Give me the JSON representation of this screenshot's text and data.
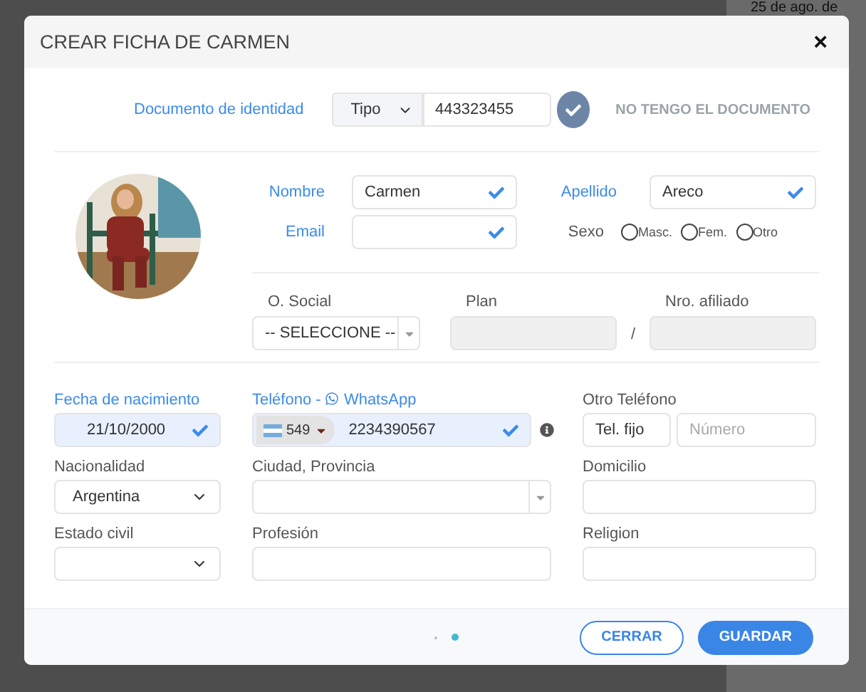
{
  "backdrop": {
    "date": "25 de ago. de"
  },
  "modal": {
    "title": "CREAR FICHA DE CARMEN",
    "close": "×"
  },
  "document": {
    "label": "Documento de identidad",
    "type": "Tipo",
    "value": "443323455",
    "confirmed": true,
    "no_document": "NO TENGO EL DOCUMENTO"
  },
  "person": {
    "name": {
      "label": "Nombre",
      "value": "Carmen",
      "required": true,
      "valid": true
    },
    "surname": {
      "label": "Apellido",
      "value": "Areco",
      "required": true,
      "valid": true
    },
    "email": {
      "label": "Email",
      "required": true,
      "valid": true
    },
    "sex": {
      "label": "Sexo",
      "options": [
        {
          "label": "Masc.",
          "selected": false
        },
        {
          "label": "Fem.",
          "selected": false
        },
        {
          "label": "Otro",
          "selected": false
        }
      ]
    }
  },
  "insurance": {
    "social": {
      "label": "O. Social",
      "value": "-- SELECCIONE --"
    },
    "plan": {
      "label": "Plan"
    },
    "separator": "/",
    "member": {
      "label": "Nro. afiliado"
    }
  },
  "birth": {
    "label": "Fecha de nacimiento",
    "value": "21/10/2000",
    "required": true,
    "valid": true,
    "autofilled": true
  },
  "phone": {
    "label": "Teléfono - ",
    "whatsapp": "WhatsApp",
    "code": "549",
    "value": "2234390567",
    "required": true,
    "valid": true,
    "autofilled": true
  },
  "other_phone": {
    "label": "Otro Teléfono",
    "type": "Tel. fijo",
    "placeholder": "Número"
  },
  "fields": [
    {
      "kind": "select",
      "label": "Nacionalidad",
      "value": "Argentina"
    },
    {
      "kind": "combo",
      "label": "Ciudad, Provincia"
    },
    {
      "kind": "text",
      "label": "Domicilio"
    },
    {
      "kind": "select",
      "label": "Estado civil"
    },
    {
      "kind": "text",
      "label": "Profesión"
    },
    {
      "kind": "text",
      "label": "Religion"
    }
  ],
  "pages": [
    {
      "selected": false
    },
    {
      "selected": true
    }
  ],
  "buttons": [
    {
      "kind": "outline",
      "label": "CERRAR"
    },
    {
      "kind": "primary",
      "label": "GUARDAR"
    }
  ]
}
